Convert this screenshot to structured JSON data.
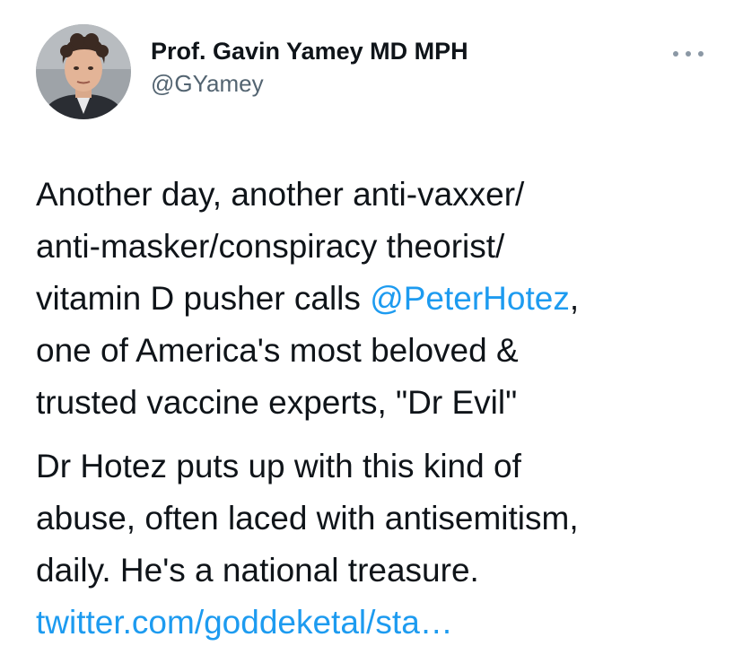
{
  "author": {
    "display_name": "Prof. Gavin Yamey MD MPH",
    "handle": "@GYamey",
    "avatar_icon": "user-avatar"
  },
  "more_icon": "more-horizontal-icon",
  "colors": {
    "text": "#0f1419",
    "secondary": "#536471",
    "link": "#1d9bf0"
  },
  "tweet": {
    "p1": {
      "line1": "Another day, another anti-vaxxer/",
      "line2": "anti-masker/conspiracy theorist/",
      "line3_before": "vitamin D pusher calls ",
      "mention": "@PeterHotez",
      "line3_after": ",",
      "line4": "one of America's most beloved &",
      "line5": "trusted vaccine experts, \"Dr Evil\""
    },
    "p2": {
      "line1": "Dr Hotez puts up with this kind of",
      "line2": "abuse, often laced with antisemitism,",
      "line3": "daily. He's a national treasure."
    },
    "link": "twitter.com/goddeketal/sta…"
  }
}
